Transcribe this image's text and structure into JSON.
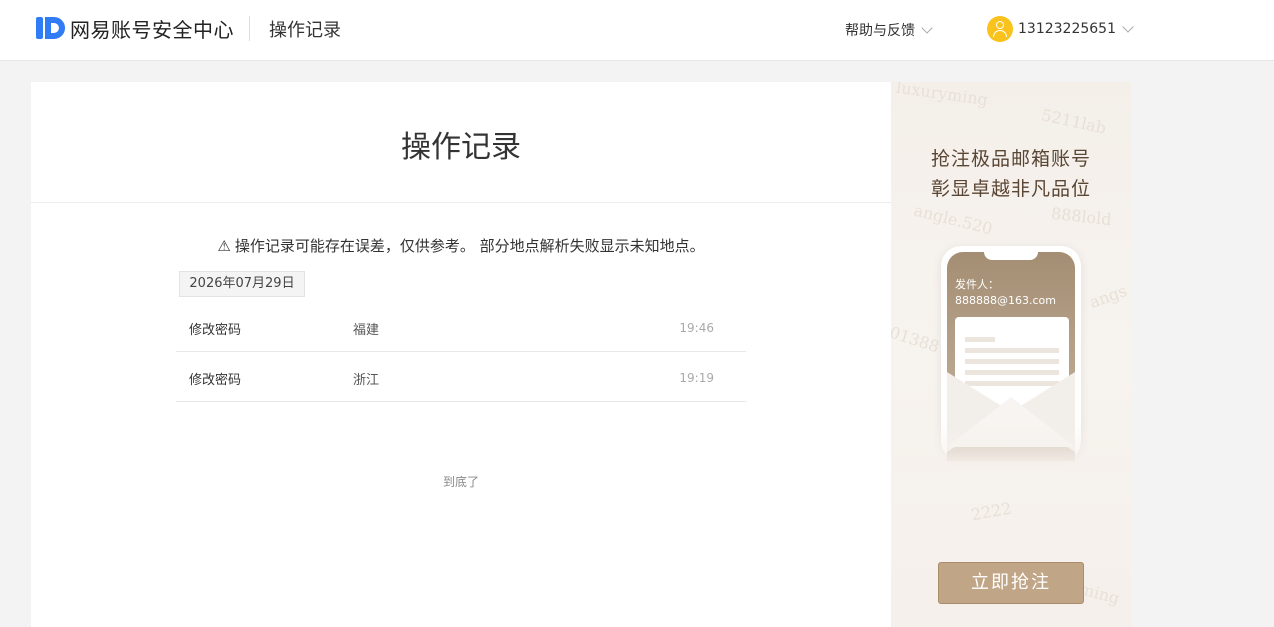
{
  "header": {
    "logo_text": "网易账号安全中心",
    "section_title": "操作记录",
    "help_label": "帮助与反馈",
    "user_phone": "13123225651"
  },
  "main": {
    "title": "操作记录",
    "notice_icon": "⚠",
    "notice": "操作记录可能存在误差，仅供参考。 部分地点解析失败显示未知地点。",
    "date": "2026年07月29日",
    "records": [
      {
        "action": "修改密码",
        "location": "福建",
        "time": "19:46"
      },
      {
        "action": "修改密码",
        "location": "浙江",
        "time": "19:19"
      }
    ],
    "end_text": "到底了"
  },
  "ad": {
    "title_line1": "抢注极品邮箱账号",
    "title_line2": "彰显卓越非凡品位",
    "sender_label": "发件人：",
    "sender_email": "888888@163.com",
    "watermarks": [
      "luxuryming",
      "5211lab",
      "angle.520",
      "888lold",
      "01388",
      "angs",
      "2222",
      "ming"
    ],
    "button_label": "立即抢注"
  },
  "colors": {
    "brand_blue": "#2f7cf6",
    "avatar_yellow": "#f9c21c",
    "ad_button": "#c0a586"
  }
}
